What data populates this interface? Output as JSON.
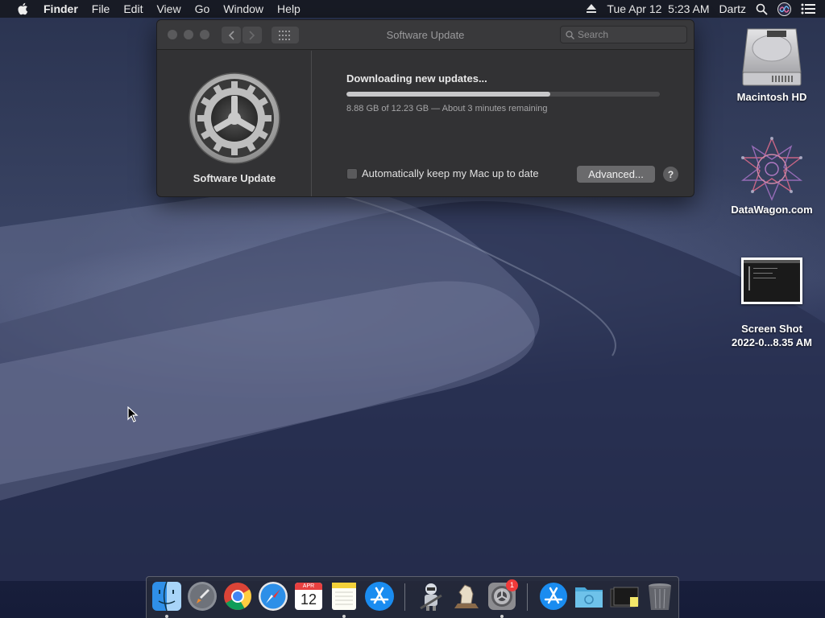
{
  "menubar": {
    "app_name": "Finder",
    "items": [
      "File",
      "Edit",
      "View",
      "Go",
      "Window",
      "Help"
    ],
    "datetime": "Tue Apr 12  5:23 AM",
    "user": "Dartz",
    "icons": [
      "apple-logo",
      "eject-icon",
      "spotlight-icon",
      "siri-icon",
      "notification-center-icon"
    ]
  },
  "window": {
    "title": "Software Update",
    "search_placeholder": "Search",
    "pane_title": "Software Update",
    "status_text": "Downloading new updates...",
    "progress_fraction": 0.65,
    "detail_text": "8.88 GB of 12.23 GB — About 3 minutes remaining",
    "auto_update_label": "Automatically keep my Mac up to date",
    "auto_update_checked": false,
    "advanced_button": "Advanced...",
    "help_button": "?"
  },
  "desktop_icons": [
    {
      "label": "Macintosh HD",
      "icon": "hard-drive-icon"
    },
    {
      "label": "DataWagon.com",
      "icon": "datawagon-icon"
    },
    {
      "label": "Screen Shot 2022-0...8.35 AM",
      "label_line1": "Screen Shot",
      "label_line2": "2022-0...8.35 AM",
      "icon": "screenshot-thumbnail"
    }
  ],
  "dock": {
    "calendar_month": "APR",
    "calendar_day": "12",
    "system_prefs_badge": "1",
    "items": [
      "finder",
      "launchpad",
      "chrome",
      "safari",
      "calendar",
      "notes",
      "app-store",
      "automator",
      "chess",
      "system-preferences",
      "app-store-downloads",
      "folder",
      "screenshot-stack",
      "trash"
    ]
  }
}
